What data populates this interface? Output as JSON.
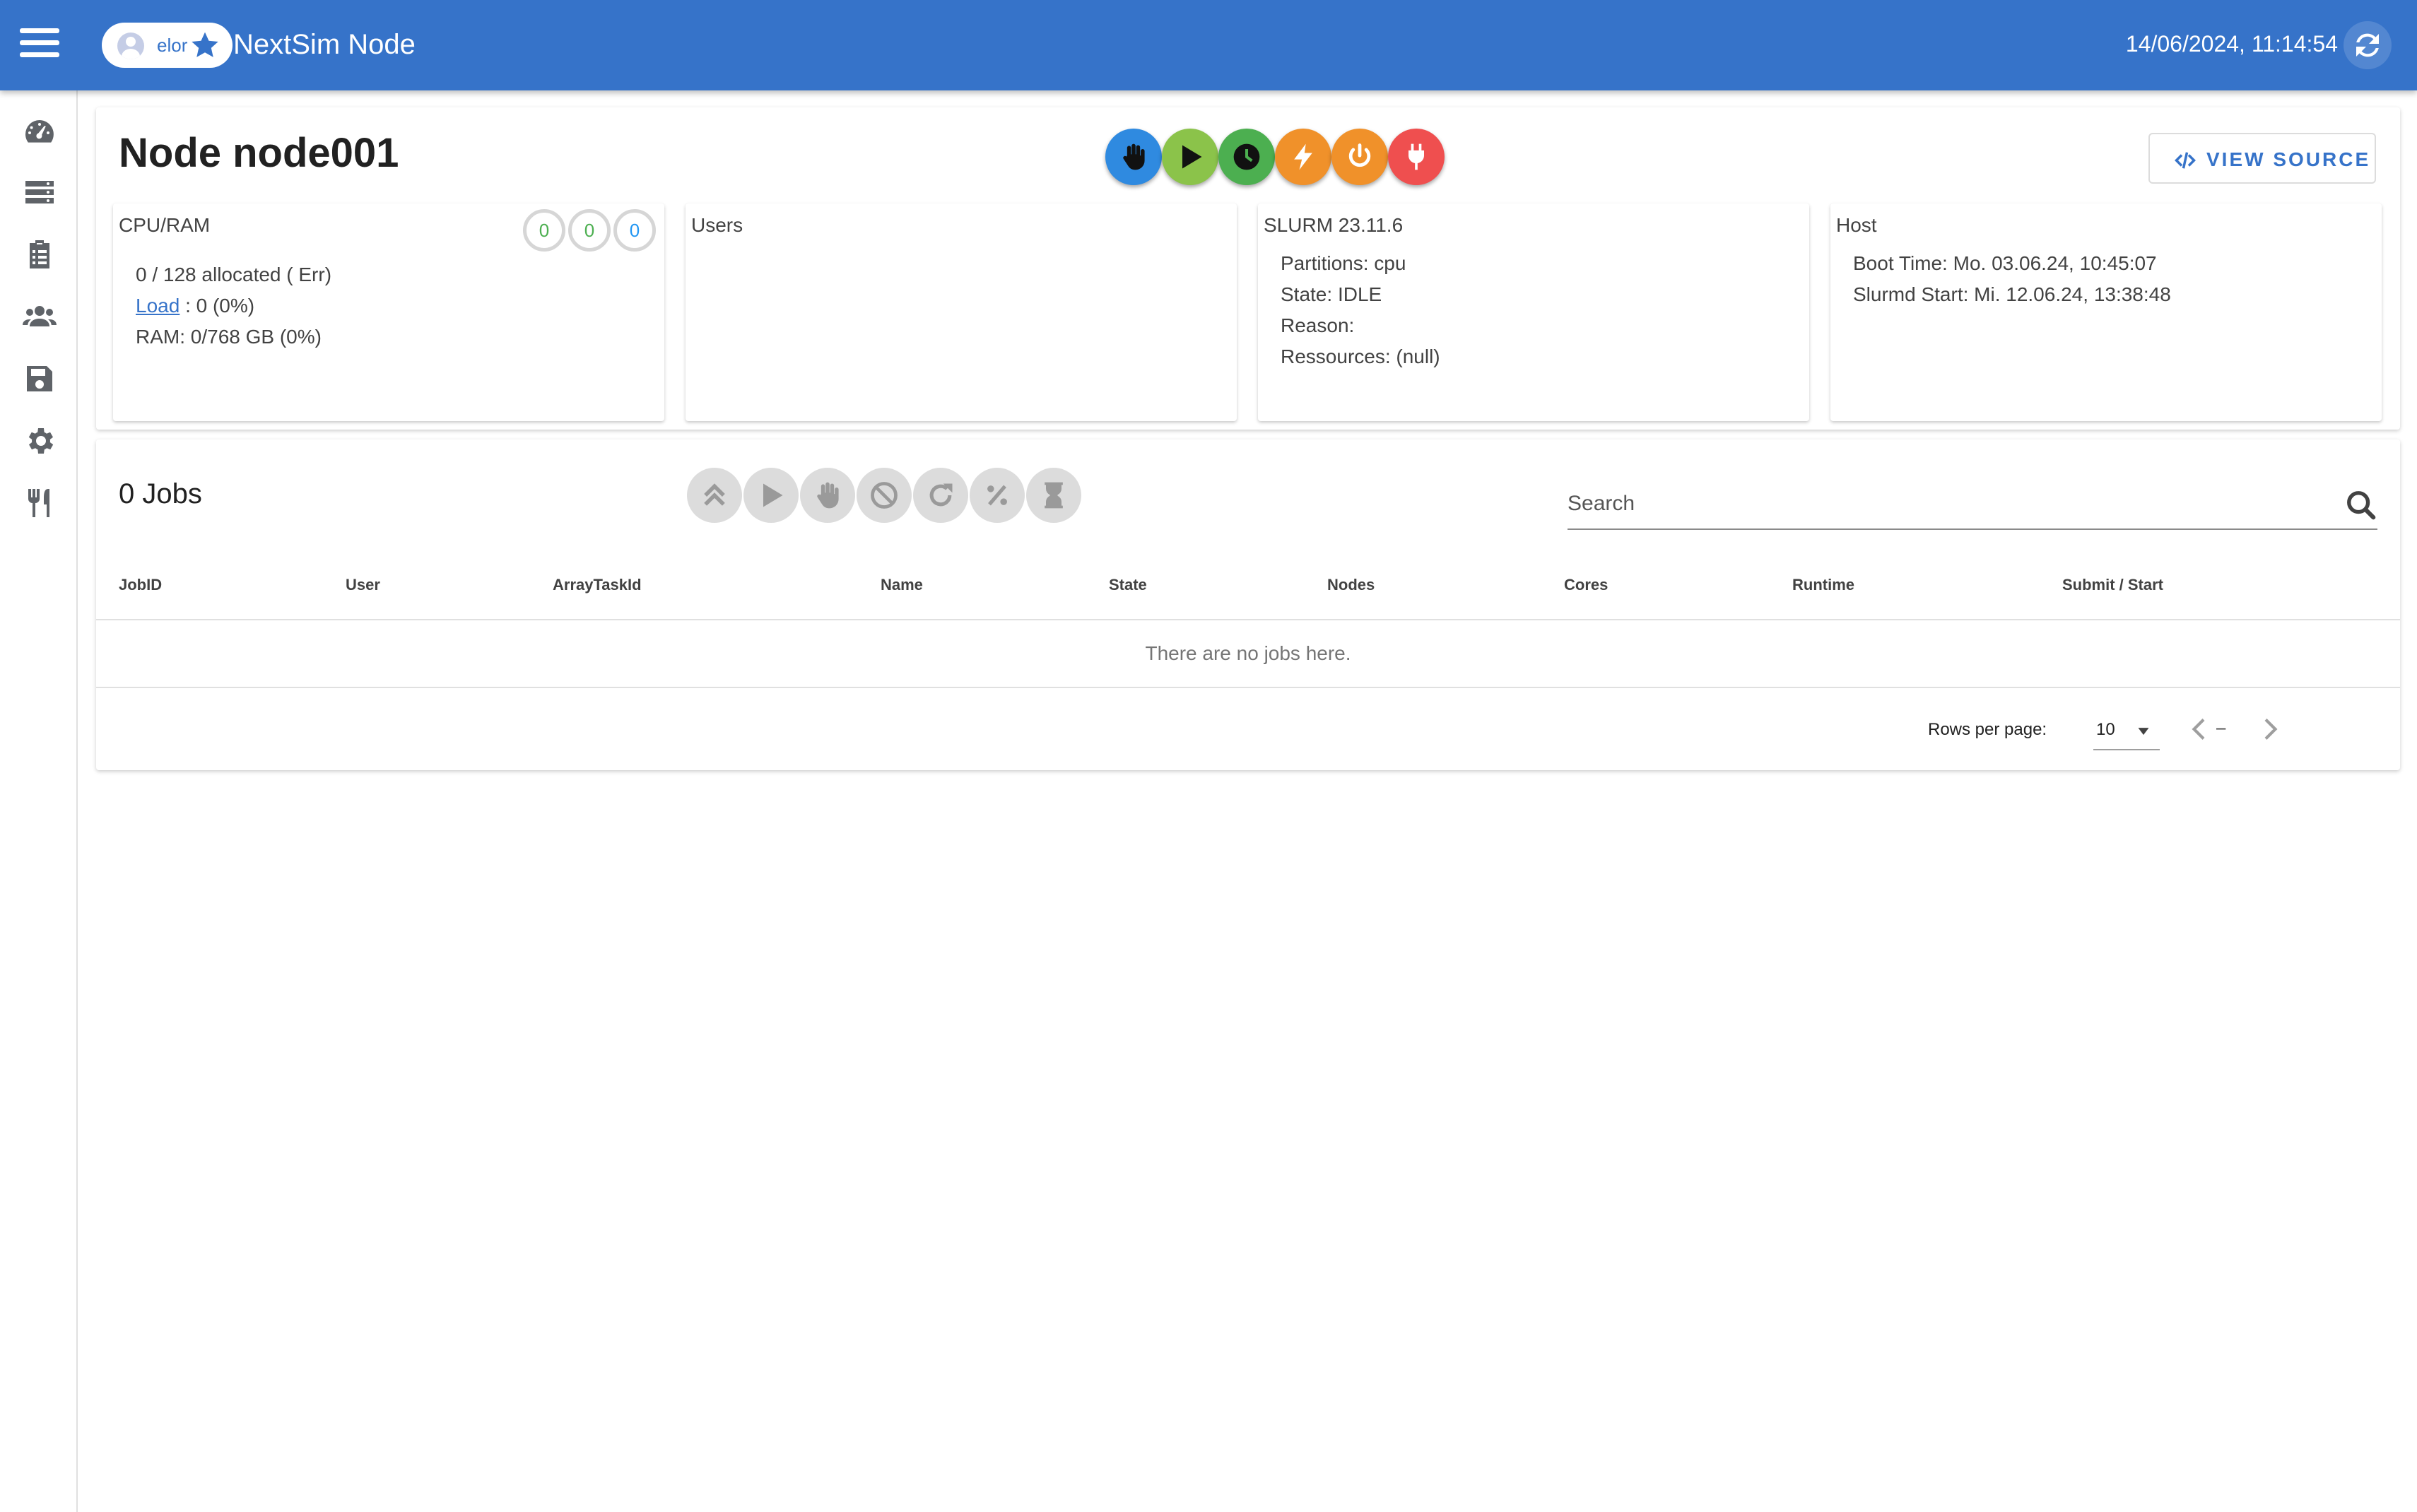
{
  "appbar": {
    "title": "NextSim Node",
    "user": "elor",
    "datetime": "14/06/2024, 11:14:54",
    "color": "#3673c9"
  },
  "sidebar": {
    "items": [
      "dashboard-icon",
      "nodes-icon",
      "jobs-icon",
      "users-icon",
      "storage-icon",
      "settings-icon",
      "restaurant-icon"
    ]
  },
  "node": {
    "title": "Node node001",
    "actions": [
      {
        "name": "drain",
        "icon": "hand-icon",
        "color": "#2f8ae0"
      },
      {
        "name": "resume",
        "icon": "play-icon",
        "color": "#8bc34a"
      },
      {
        "name": "reservation",
        "icon": "clock-icon",
        "color": "#4caf50"
      },
      {
        "name": "reboot",
        "icon": "bolt-icon",
        "color": "#f0912a"
      },
      {
        "name": "power",
        "icon": "power-icon",
        "color": "#f0912a"
      },
      {
        "name": "plug",
        "icon": "plug-icon",
        "color": "#ef4f4f"
      }
    ],
    "view_source_label": "VIEW SOURCE",
    "cpu_ram": {
      "title": "CPU/RAM",
      "badges": [
        {
          "value": "0",
          "color": "#4caf50"
        },
        {
          "value": "0",
          "color": "#4caf50"
        },
        {
          "value": "0",
          "color": "#2196f3"
        }
      ],
      "allocated": "0 / 128 allocated ( Err)",
      "load_link": "Load",
      "load_value": " : 0 (0%)",
      "ram": "RAM: 0/768 GB (0%)"
    },
    "users": {
      "title": "Users"
    },
    "slurm": {
      "title": "SLURM 23.11.6",
      "partitions": "Partitions: cpu",
      "state": "State: IDLE",
      "reason": "Reason:",
      "resources": "Ressources: (null)"
    },
    "host": {
      "title": "Host",
      "boot_time": "Boot Time: Mo. 03.06.24, 10:45:07",
      "slurmd_start": "Slurmd Start: Mi. 12.06.24, 13:38:48"
    }
  },
  "jobs": {
    "title": "0 Jobs",
    "toolbar": [
      "priority-up-icon",
      "play-icon",
      "hold-icon",
      "cancel-icon",
      "requeue-icon",
      "percent-icon",
      "hourglass-icon"
    ],
    "search_placeholder": "Search",
    "columns": [
      "JobID",
      "User",
      "ArrayTaskId",
      "Name",
      "State",
      "Nodes",
      "Cores",
      "Runtime",
      "Submit / Start"
    ],
    "empty_message": "There are no jobs here.",
    "rows_per_page_label": "Rows per page:",
    "rows_per_page": "10",
    "range": "–"
  }
}
